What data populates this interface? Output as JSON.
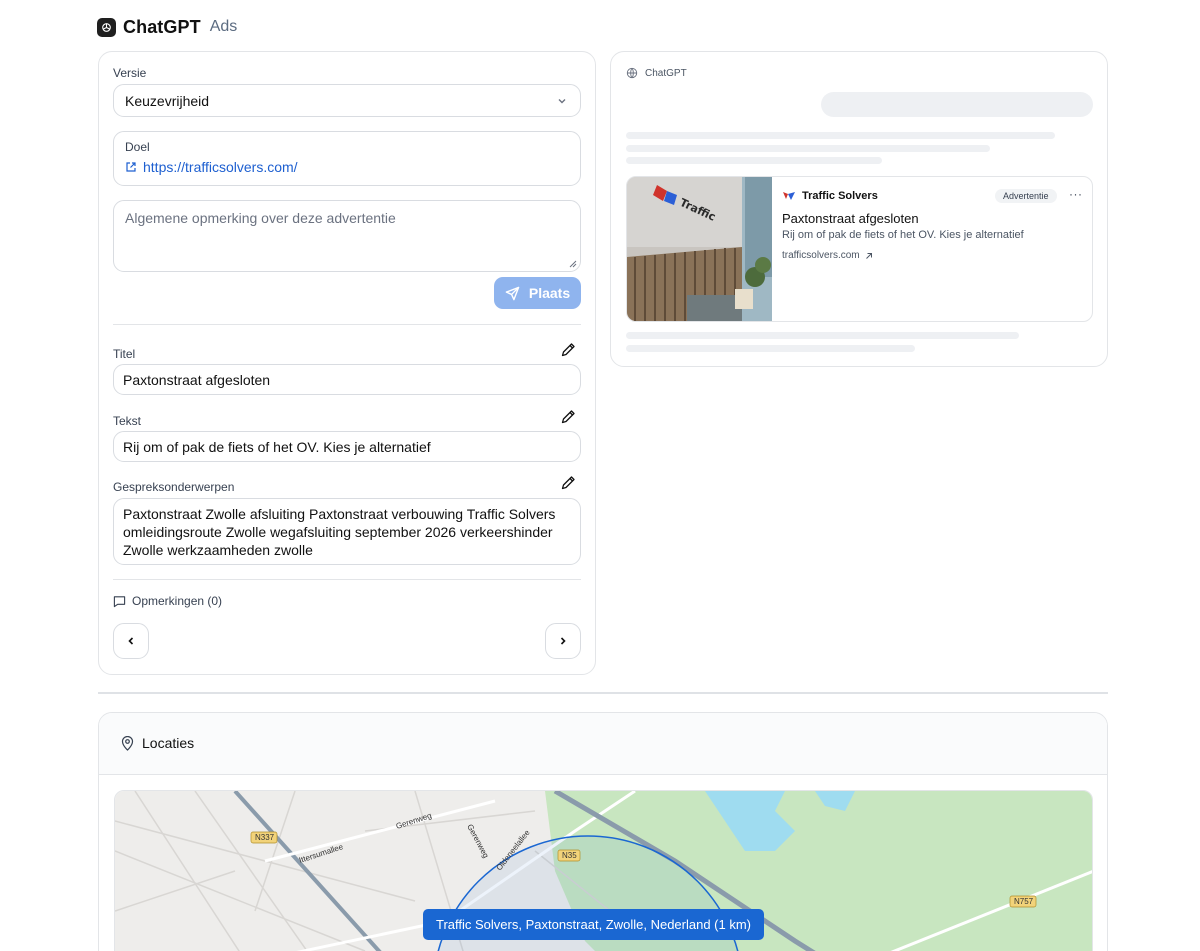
{
  "header": {
    "brand": "ChatGPT",
    "sub": "Ads"
  },
  "form": {
    "versie_label": "Versie",
    "versie_value": "Keuzevrijheid",
    "doel_label": "Doel",
    "doel_url": "https://trafficsolvers.com/",
    "remark_placeholder": "Algemene opmerking over deze advertentie",
    "place_button": "Plaats",
    "titel_label": "Titel",
    "titel_value": "Paxtonstraat afgesloten",
    "tekst_label": "Tekst",
    "tekst_value": "Rij om of pak de fiets of het OV. Kies je alternatief",
    "topics_label": "Gespreksonderwerpen",
    "topics_value": "Paxtonstraat Zwolle afsluiting Paxtonstraat verbouwing Traffic Solvers omleidingsroute Zwolle wegafsluiting september 2026 verkeershinder Zwolle werkzaamheden zwolle",
    "comments_label": "Opmerkingen (0)"
  },
  "preview": {
    "header": "ChatGPT",
    "ad": {
      "brand": "Traffic Solvers",
      "badge": "Advertentie",
      "more": "···",
      "title": "Paxtonstraat afgesloten",
      "text": "Rij om of pak de fiets of het OV. Kies je alternatief",
      "domain": "trafficsolvers.com"
    }
  },
  "locations": {
    "title": "Locaties",
    "tooltip": "Traffic Solvers, Paxtonstraat, Zwolle, Nederland (1 km)",
    "map_labels": [
      "N337",
      "N35",
      "N757",
      "Ittersumallee",
      "Gerenweg",
      "Gerenweg",
      "Oldeneelallee"
    ]
  },
  "colors": {
    "accent": "#1d5fd0",
    "button": "#8fb4ee",
    "tooltip": "#1a67d2"
  },
  "icons": [
    "openai-logo-icon",
    "chevron-down-icon",
    "external-link-icon",
    "send-icon",
    "pencil-icon",
    "comment-icon",
    "chevron-left-icon",
    "chevron-right-icon",
    "globe-icon",
    "map-pin-icon"
  ]
}
